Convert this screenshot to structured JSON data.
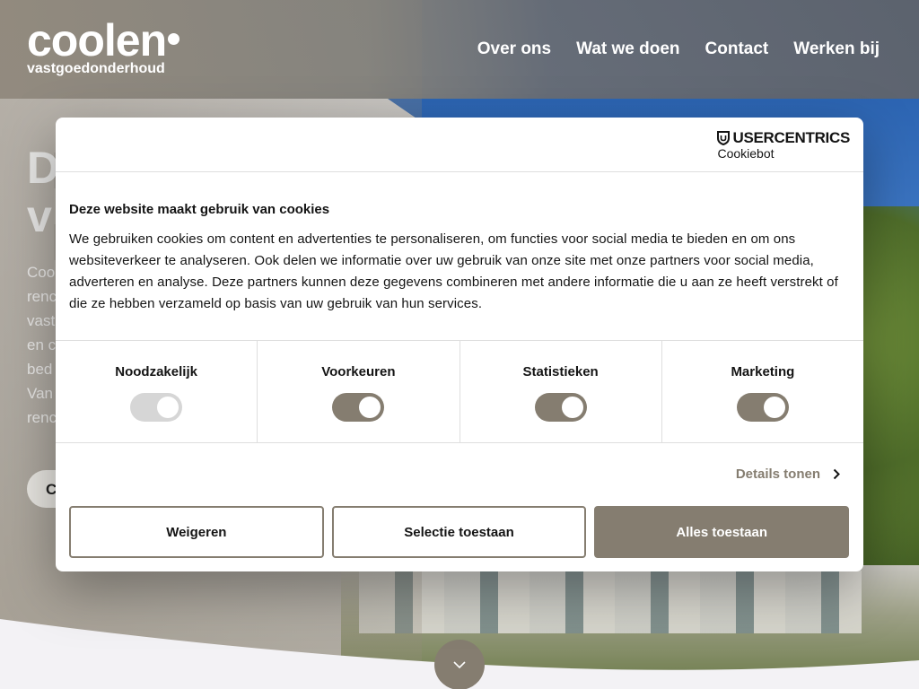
{
  "header": {
    "logo_main": "coolen",
    "logo_sub": "vastgoedonderhoud",
    "nav": [
      "Over ons",
      "Wat we doen",
      "Contact",
      "Werken bij"
    ]
  },
  "hero": {
    "title_line1": "D",
    "title_line2": "v",
    "body_lines": [
      "Coo",
      "renc",
      "vast",
      "en c",
      "bed",
      "Van",
      "renc"
    ],
    "button_label": "C"
  },
  "cookie_dialog": {
    "brand_top": "USERCENTRICS",
    "brand_bottom": "Cookiebot",
    "title": "Deze website maakt gebruik van cookies",
    "text": "We gebruiken cookies om content en advertenties te personaliseren, om functies voor social media te bieden en om ons websiteverkeer te analyseren. Ook delen we informatie over uw gebruik van onze site met onze partners voor social media, adverteren en analyse. Deze partners kunnen deze gegevens combineren met andere informatie die u aan ze heeft verstrekt of die ze hebben verzameld op basis van uw gebruik van hun services.",
    "toggles": [
      {
        "label": "Noodzakelijk",
        "on": true,
        "disabled": true
      },
      {
        "label": "Voorkeuren",
        "on": true,
        "disabled": false
      },
      {
        "label": "Statistieken",
        "on": true,
        "disabled": false
      },
      {
        "label": "Marketing",
        "on": true,
        "disabled": false
      }
    ],
    "details_label": "Details tonen",
    "buttons": {
      "reject": "Weigeren",
      "allow_selection": "Selectie toestaan",
      "allow_all": "Alles toestaan"
    }
  },
  "colors": {
    "accent": "#857d70",
    "toggle_disabled": "#d6d6d6"
  },
  "icons": {
    "details": "chevron-right-icon",
    "scroll": "chevron-down-icon",
    "brand": "shield-icon"
  }
}
